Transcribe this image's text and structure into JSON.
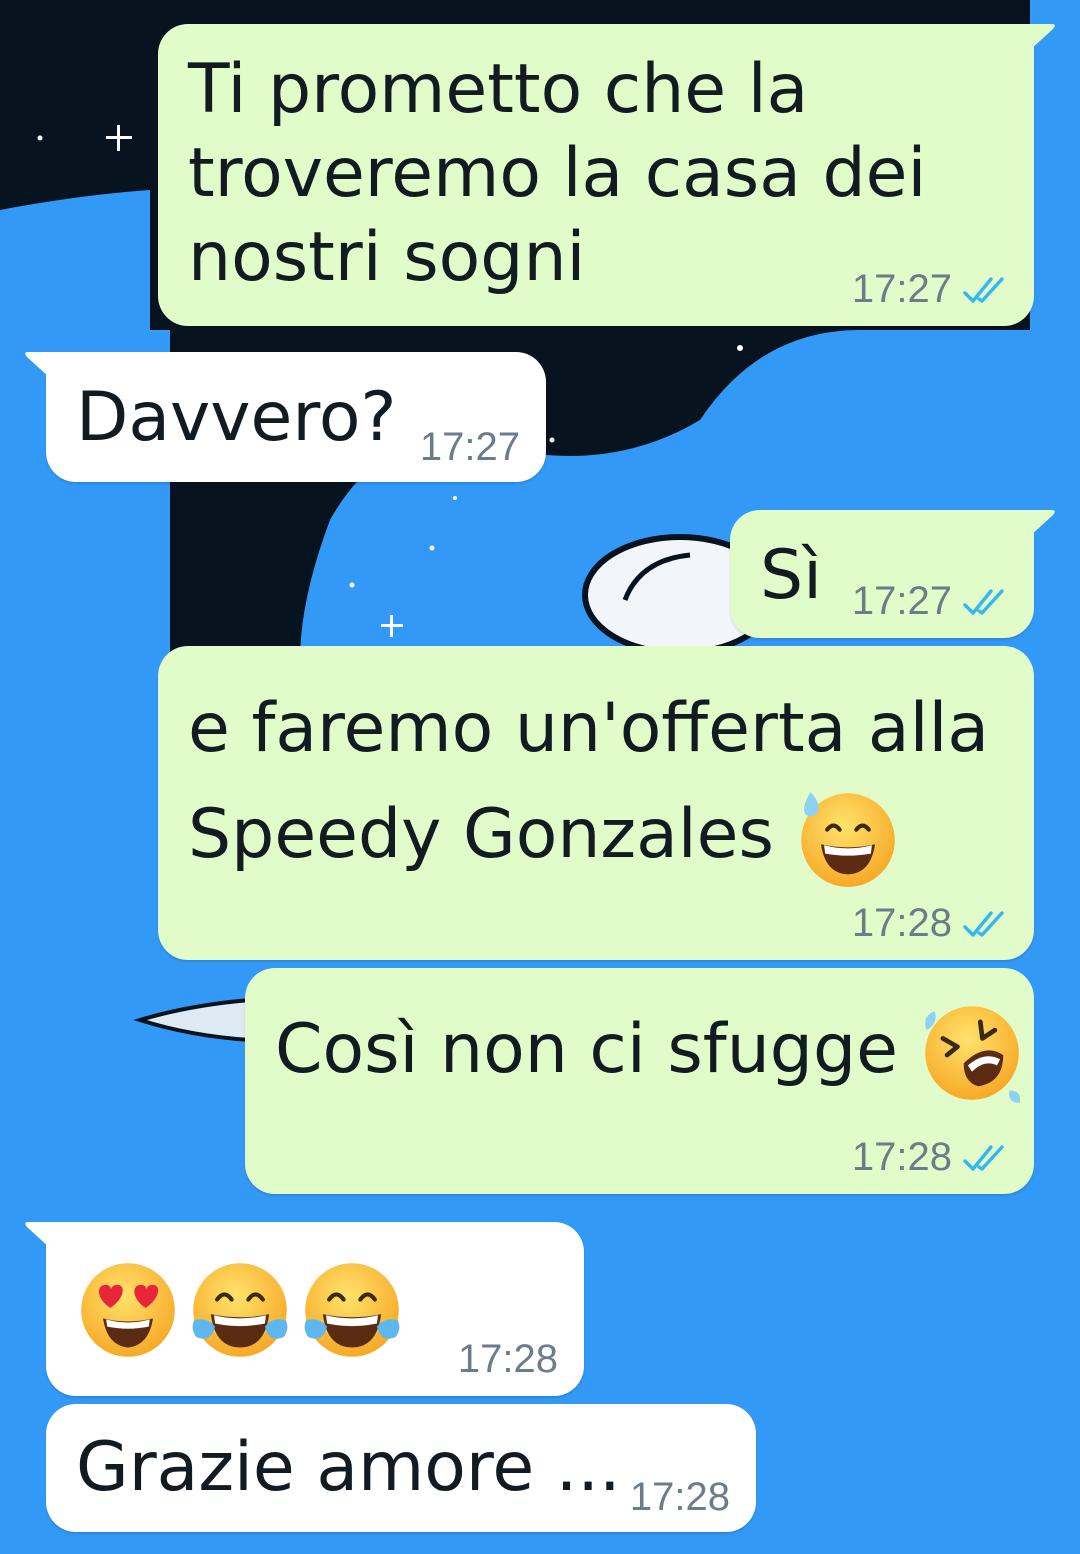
{
  "colors": {
    "wallpaper_blue": "#3399f6",
    "wallpaper_dark": "#07141f",
    "outgoing_bubble": "#e1fcc9",
    "incoming_bubble": "#ffffff",
    "read_ticks": "#34b7f1",
    "timestamp": "#6a7d88"
  },
  "messages": [
    {
      "id": "m1",
      "direction": "outgoing",
      "text": "Ti prometto che la\ntroveremo la casa dei\nnostri sogni",
      "time": "17:27",
      "status": "read"
    },
    {
      "id": "m2",
      "direction": "incoming",
      "text": "Davvero?",
      "time": "17:27"
    },
    {
      "id": "m3",
      "direction": "outgoing",
      "text": "Sì",
      "time": "17:27",
      "status": "read"
    },
    {
      "id": "m4",
      "direction": "outgoing",
      "text": "e faremo un'offerta alla\nSpeedy Gonzales",
      "emojis": [
        "grinning-sweat-emoji"
      ],
      "time": "17:28",
      "status": "read"
    },
    {
      "id": "m5",
      "direction": "outgoing",
      "text": "Così non ci sfugge",
      "emojis": [
        "rolling-on-floor-laughing-emoji"
      ],
      "time": "17:28",
      "status": "read"
    },
    {
      "id": "m6",
      "direction": "incoming",
      "text": "",
      "emojis": [
        "heart-eyes-emoji",
        "tears-of-joy-emoji",
        "tears-of-joy-emoji"
      ],
      "time": "17:28"
    },
    {
      "id": "m7",
      "direction": "incoming",
      "text": "Grazie amore ...",
      "time": "17:28"
    }
  ]
}
